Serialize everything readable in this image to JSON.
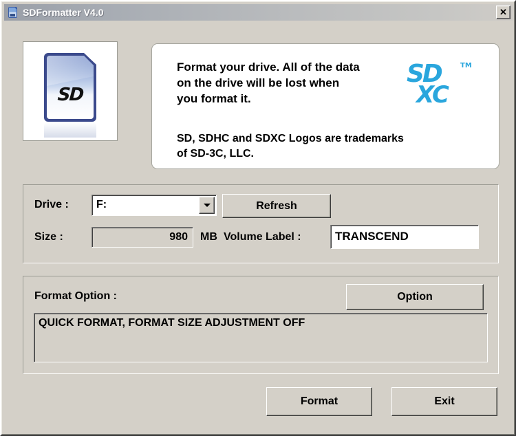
{
  "window": {
    "title": "SDFormatter V4.0",
    "icon": "sdcard-app-icon",
    "close_label": "✕"
  },
  "notice": {
    "message": "Format your drive. All of the data\non the drive will be lost when\nyou format it.",
    "trademark": "SD, SDHC and SDXC Logos are trademarks\nof SD-3C, LLC.",
    "logo": {
      "sd": "SD",
      "tm": "TM",
      "xc": "XC",
      "color": "#2aa6dd"
    },
    "card_image": {
      "icon": "sd-card-image",
      "logo_text": "SD"
    }
  },
  "drive_section": {
    "drive_label": "Drive :",
    "drive_value": "F:",
    "drive_options": [
      "F:"
    ],
    "refresh_label": "Refresh",
    "size_label": "Size :",
    "size_value": "980",
    "size_unit": "MB",
    "volume_label_caption": "Volume Label :",
    "volume_label_value": "TRANSCEND"
  },
  "format_option_section": {
    "caption": "Format Option :",
    "option_button_label": "Option",
    "summary": "QUICK FORMAT, FORMAT SIZE ADJUSTMENT OFF"
  },
  "actions": {
    "format_label": "Format",
    "exit_label": "Exit"
  },
  "colors": {
    "window_background": "#d4d0c8",
    "accent": "#2aa6dd",
    "titlebar_start": "#9a9fa8",
    "titlebar_end": "#cfccc7"
  }
}
